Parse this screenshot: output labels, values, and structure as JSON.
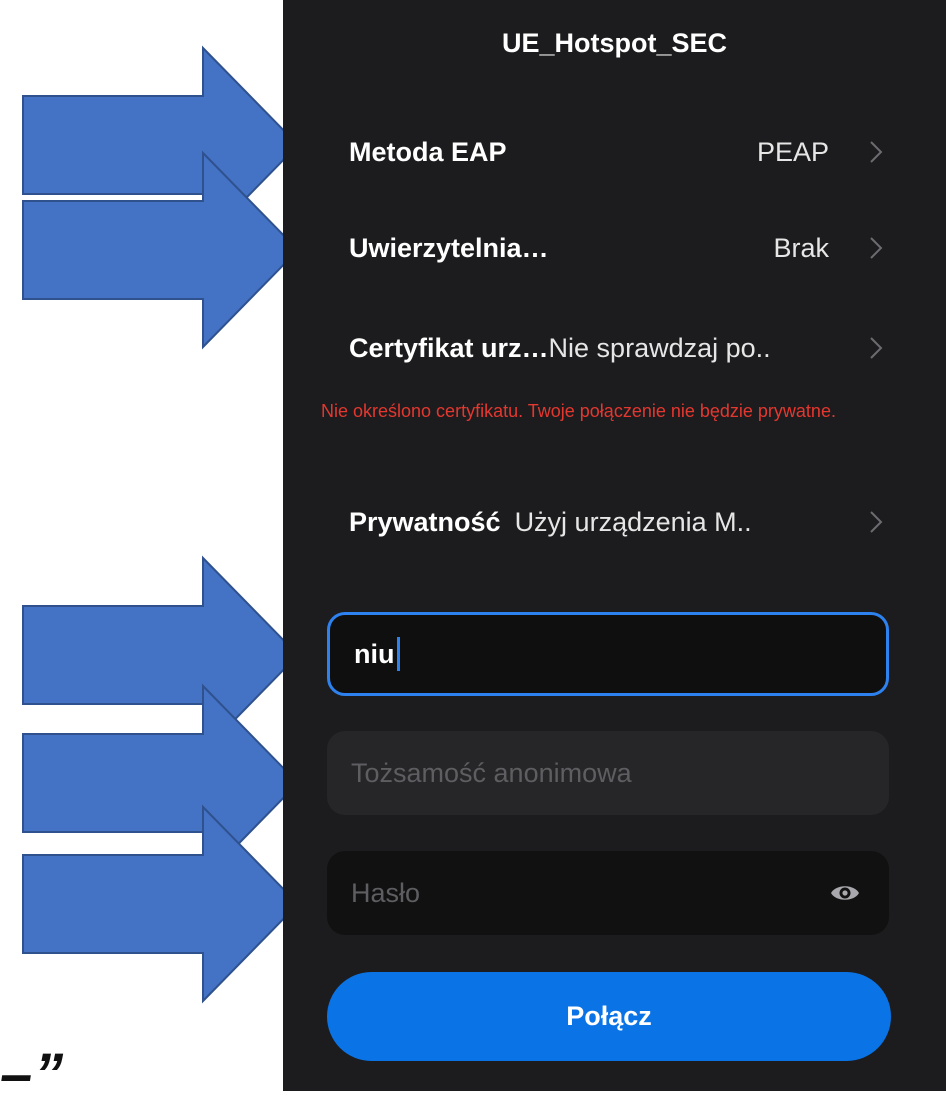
{
  "network": {
    "title": "UE_Hotspot_SEC"
  },
  "settings": {
    "eap_method": {
      "label": "Metoda EAP",
      "value": "PEAP"
    },
    "phase2_auth": {
      "label": "Uwierzytelnia…",
      "value": "Brak"
    },
    "ca_certificate": {
      "label": "Certyfikat urz…",
      "value": "Nie sprawdzaj po.."
    },
    "warning": "Nie określono certyfikatu. Twoje połączenie nie będzie prywatne.",
    "privacy": {
      "label": "Prywatność",
      "value": "Użyj urządzenia M.."
    }
  },
  "fields": {
    "identity": {
      "value": "niu"
    },
    "anonymous_identity": {
      "placeholder": "Tożsamość anonimowa"
    },
    "password": {
      "placeholder": "Hasło"
    }
  },
  "actions": {
    "connect_label": "Połącz"
  },
  "annotation": {
    "fragment": "–”"
  },
  "colors": {
    "arrow_fill": "#4472c4",
    "arrow_stroke": "#2f528f",
    "accent_blue": "#0a74e6",
    "warning_red": "#e4372f",
    "phone_background": "#1c1c1e"
  },
  "icons": {
    "chevron": "chevron-right-icon",
    "eye": "eye-icon"
  }
}
